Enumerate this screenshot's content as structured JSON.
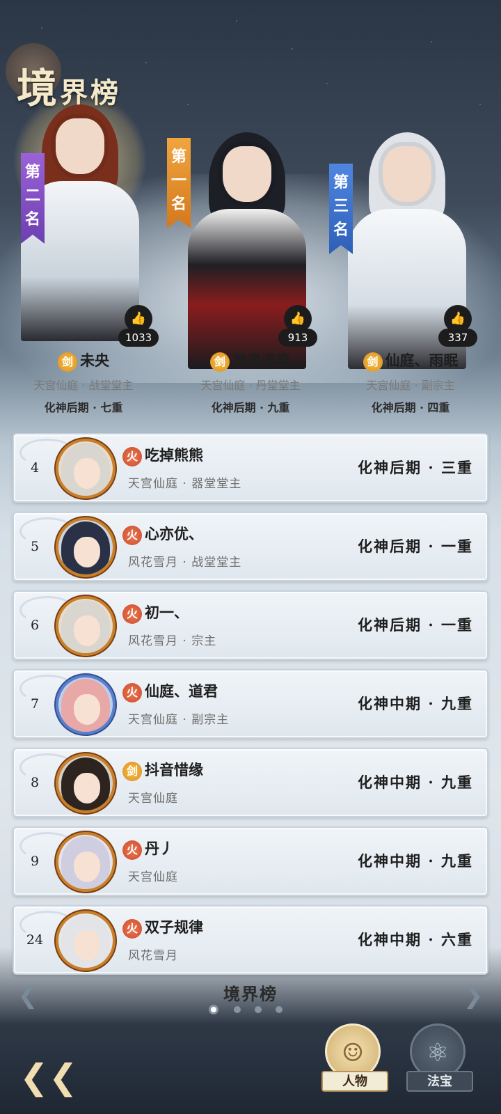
{
  "header": {
    "title_first": "境",
    "title_rest": "界榜"
  },
  "podium": [
    {
      "rank_label": "第二名",
      "likes": "1033",
      "element": "剑",
      "name": "未央",
      "sect": "天宫仙庭 · 战堂堂主",
      "realm": "化神后期 · 七重"
    },
    {
      "rank_label": "第一名",
      "likes": "913",
      "element": "剑",
      "name": "神蛊温皇",
      "sect": "天宫仙庭 · 丹堂堂主",
      "realm": "化神后期 · 九重"
    },
    {
      "rank_label": "第三名",
      "likes": "337",
      "element": "剑",
      "name": "仙庭、雨眠",
      "sect": "天宫仙庭 · 副宗主",
      "realm": "化神后期 · 四重"
    }
  ],
  "list": [
    {
      "rank": "4",
      "element": "火",
      "name": "吃掉熊熊",
      "sect": "天宫仙庭 · 器堂堂主",
      "realm": "化神后期 · 三重"
    },
    {
      "rank": "5",
      "element": "火",
      "name": "心亦优、",
      "sect": "风花雪月 · 战堂堂主",
      "realm": "化神后期 · 一重"
    },
    {
      "rank": "6",
      "element": "火",
      "name": "初一、",
      "sect": "风花雪月 · 宗主",
      "realm": "化神后期 · 一重"
    },
    {
      "rank": "7",
      "element": "火",
      "name": "仙庭、道君",
      "sect": "天宫仙庭 · 副宗主",
      "realm": "化神中期 · 九重"
    },
    {
      "rank": "8",
      "element": "剑",
      "name": "抖音惜缘",
      "sect": "天宫仙庭",
      "realm": "化神中期 · 九重"
    },
    {
      "rank": "9",
      "element": "火",
      "name": "丹丿",
      "sect": "天宫仙庭",
      "realm": "化神中期 · 九重"
    },
    {
      "rank": "24",
      "element": "火",
      "name": "双子规律",
      "sect": "风花雪月",
      "realm": "化神中期 · 六重"
    }
  ],
  "footer": {
    "board_title": "境界榜",
    "page_index": 1,
    "page_count": 4
  },
  "tabs": {
    "person_label": "人物",
    "treasure_label": "法宝"
  },
  "colors": {
    "rank1": "#e08a2a",
    "rank2": "#8350c8",
    "rank3": "#3c6fcc",
    "sword_badge": "#e9a531",
    "fire_badge": "#d95a38"
  }
}
